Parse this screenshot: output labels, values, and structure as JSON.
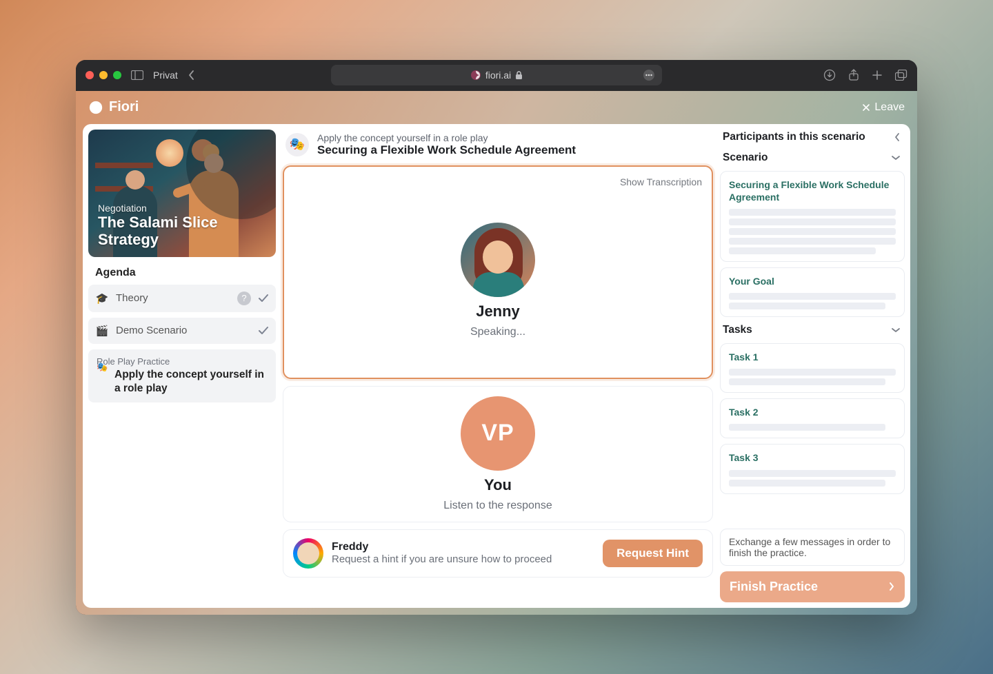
{
  "browser": {
    "privat": "Privat",
    "address": "fiori.ai"
  },
  "app": {
    "brand": "Fiori",
    "leave": "Leave"
  },
  "hero": {
    "category": "Negotiation",
    "title": "The Salami Slice Strategy"
  },
  "agenda": {
    "heading": "Agenda",
    "items": [
      {
        "icon": "🎓",
        "label": "Theory"
      },
      {
        "icon": "🎬",
        "label": "Demo Scenario"
      }
    ],
    "active": {
      "icon": "🎭",
      "sub": "Role Play Practice",
      "title": "Apply the concept yourself in a role play"
    }
  },
  "mid": {
    "overline": "Apply the concept yourself in a role play",
    "title": "Securing a Flexible Work Schedule Agreement",
    "show_transcription": "Show Transcription",
    "speaker": {
      "name": "Jenny",
      "status": "Speaking..."
    },
    "you": {
      "initials": "VP",
      "name": "You",
      "status": "Listen to the response"
    },
    "assist": {
      "name": "Freddy",
      "sub": "Request a hint if you are unsure how to proceed",
      "button": "Request Hint"
    }
  },
  "right": {
    "participants": "Participants in this scenario",
    "scenario": "Scenario",
    "scenario_title": "Securing a Flexible Work Schedule Agreement",
    "goal": "Your Goal",
    "tasks_heading": "Tasks",
    "tasks": [
      "Task 1",
      "Task 2",
      "Task 3"
    ],
    "note": "Exchange a few messages in order to finish the practice.",
    "finish": "Finish Practice"
  }
}
